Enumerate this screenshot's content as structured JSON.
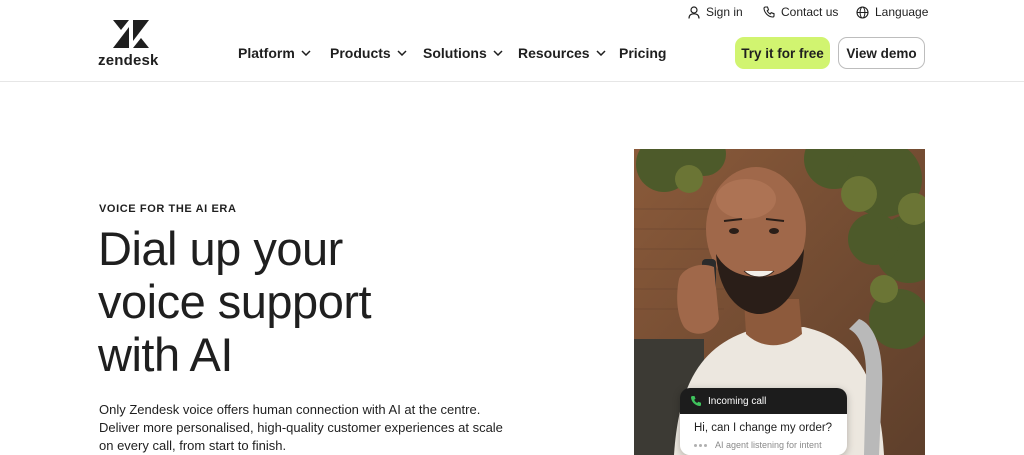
{
  "header": {
    "brand": "zendesk",
    "utility": {
      "signin": "Sign in",
      "contact": "Contact us",
      "language": "Language"
    },
    "nav": {
      "platform": "Platform",
      "products": "Products",
      "solutions": "Solutions",
      "resources": "Resources",
      "pricing": "Pricing"
    },
    "cta": {
      "try": "Try it for free",
      "demo": "View demo"
    }
  },
  "hero": {
    "eyebrow": "VOICE FOR THE AI ERA",
    "headline": [
      "Dial up your",
      "voice support",
      "with AI"
    ],
    "body": [
      "Only Zendesk voice offers human connection with AI at the centre.",
      "Deliver more personalised, high-quality customer experiences at scale",
      "on every call, from start to finish."
    ]
  },
  "call_card": {
    "label": "Incoming call",
    "question": "Hi, can I change my order?",
    "status": "AI agent listening for intent"
  },
  "colors": {
    "accent": "#d1f470",
    "text": "#1f1f1f",
    "call_header": "#1c1c1c"
  },
  "icons": [
    "zendesk-logo",
    "user-icon",
    "phone-icon",
    "globe-icon",
    "chevron-down-icon",
    "phone-incoming-icon"
  ]
}
